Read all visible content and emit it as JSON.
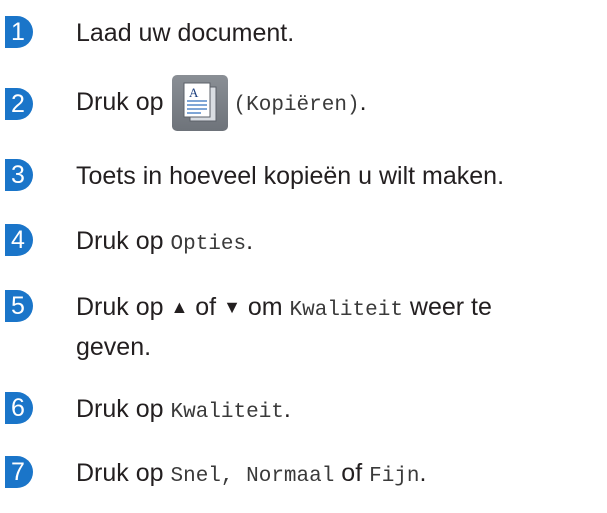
{
  "steps": [
    {
      "number": "1",
      "parts": [
        "Laad uw document."
      ]
    },
    {
      "number": "2",
      "prefix": "Druk op",
      "icon": "copy-icon",
      "suffix": "(Kopiëren)",
      "end": "."
    },
    {
      "number": "3",
      "parts": [
        "Toets in hoeveel kopieën u wilt maken."
      ]
    },
    {
      "number": "4",
      "prefix": "Druk op ",
      "option": "Opties",
      "end": "."
    },
    {
      "number": "5",
      "prefix": "Druk op ",
      "up": "▲",
      "of": " of ",
      "down": "▼",
      "om": " om ",
      "option": "Kwaliteit",
      "line1_end": " weer te",
      "line2": "geven."
    },
    {
      "number": "6",
      "prefix": "Druk op ",
      "option": "Kwaliteit",
      "end": "."
    },
    {
      "number": "7",
      "prefix": "Druk op ",
      "opt1": "Snel",
      "comma": ", ",
      "opt2": "Normaal",
      "of": " of ",
      "opt3": "Fijn",
      "end": "."
    }
  ],
  "colors": {
    "badge": "#1a75c9",
    "text": "#231f20"
  }
}
